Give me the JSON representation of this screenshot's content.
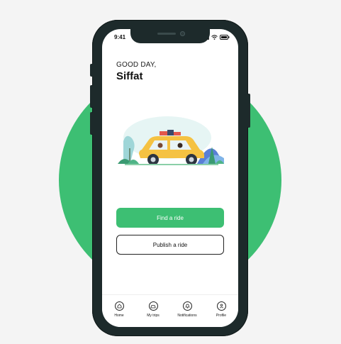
{
  "status_bar": {
    "time": "9:41"
  },
  "greeting": {
    "salutation": "GOOD DAY,",
    "name": "Siffat"
  },
  "actions": {
    "find": "Find a ride",
    "publish": "Publish a ride"
  },
  "tabs": [
    {
      "label": "Home",
      "icon": "home-icon"
    },
    {
      "label": "My trips",
      "icon": "trips-icon"
    },
    {
      "label": "Notifications",
      "icon": "bell-icon"
    },
    {
      "label": "Profile",
      "icon": "user-icon"
    }
  ],
  "colors": {
    "accent": "#3dbf73",
    "phone": "#1d2a2b"
  }
}
